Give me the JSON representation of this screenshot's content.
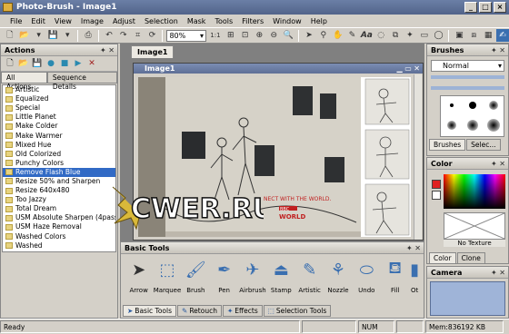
{
  "window": {
    "title": "Photo-Brush - Image1",
    "min": "_",
    "max": "□",
    "close": "×"
  },
  "menu": [
    "File",
    "Edit",
    "View",
    "Image",
    "Adjust",
    "Selection",
    "Mask",
    "Tools",
    "Filters",
    "Window",
    "Help"
  ],
  "toolbar": {
    "zoom": "80%",
    "ratio": "1:1"
  },
  "actions": {
    "title": "Actions",
    "tabs": [
      "All Actions",
      "Sequence Details"
    ],
    "items": [
      "Artistic",
      "Equalized",
      "Special",
      "Little Planet",
      "Make Colder",
      "Make Warmer",
      "Mixed Hue",
      "Old Colorized",
      "Punchy Colors",
      "Remove Flash Blue",
      "Resize 50% and Sharpen",
      "Resize 640x480",
      "Too Jazzy",
      "Total Dream",
      "USM Absolute Sharpen (4pass)",
      "USM Haze Removal",
      "Washed Colors",
      "Washed"
    ],
    "selected_index": 9
  },
  "document": {
    "tab": "Image1",
    "window_title": "Image1"
  },
  "image_text": {
    "sign_line1": "NECT WITH THE WORLD.",
    "sign_bbc": "BBC",
    "sign_world": "WORLD"
  },
  "watermark": "CWER.RU",
  "basic_tools": {
    "title": "Basic Tools",
    "tools": [
      "Arrow",
      "Marquee",
      "Brush",
      "Pen",
      "Airbrush",
      "Stamp",
      "Artistic",
      "Nozzle",
      "Undo",
      "Fill",
      "Ot"
    ],
    "tabs": [
      "Basic Tools",
      "Retouch",
      "Effects",
      "Selection Tools"
    ]
  },
  "brushes": {
    "title": "Brushes",
    "mode": "Normal",
    "tabs": [
      "Brushes",
      "Selec..."
    ]
  },
  "color": {
    "title": "Color",
    "no_texture": "No Texture",
    "tabs": [
      "Color",
      "Clone"
    ],
    "fg": "#e02020",
    "bg": "#ffffff"
  },
  "camera": {
    "title": "Camera"
  },
  "status": {
    "ready": "Ready",
    "num": "NUM",
    "mem": "Mem:836192 KB"
  }
}
